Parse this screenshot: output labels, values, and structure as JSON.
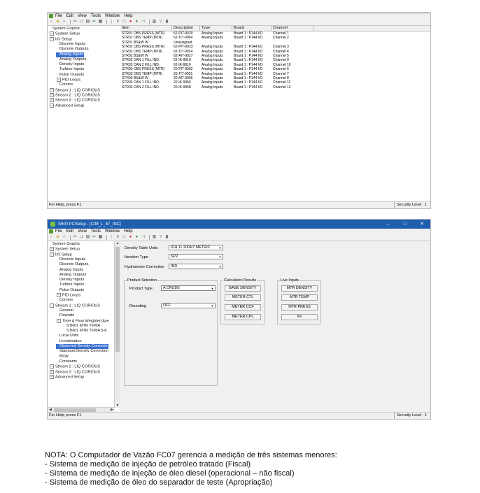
{
  "menu": [
    "File",
    "Edit",
    "View",
    "Tools",
    "Window",
    "Help"
  ],
  "window1": {
    "tree": [
      {
        "label": "System Graphic",
        "type": "leaf"
      },
      {
        "label": "System Setup",
        "type": "exp"
      },
      {
        "label": "I/O Setup",
        "type": "col"
      },
      {
        "label": "Discrete Inputs",
        "type": "leaf"
      },
      {
        "label": "Discrete Outputs",
        "type": "leaf"
      },
      {
        "label": "Analog Inputs",
        "type": "leaf",
        "selected": true
      },
      {
        "label": "Analog Outputs",
        "type": "leaf"
      },
      {
        "label": "Density Inputs",
        "type": "leaf"
      },
      {
        "label": "Turbine Inputs",
        "type": "leaf"
      },
      {
        "label": "Pulse Outputs",
        "type": "leaf"
      },
      {
        "label": "PID Loops",
        "type": "exp"
      },
      {
        "label": "Comms",
        "type": "leaf"
      },
      {
        "label": "Stream 1 : LIQ CORIOUS",
        "type": "exp"
      },
      {
        "label": "Stream 2 : LIQ CORIOUS",
        "type": "exp"
      },
      {
        "label": "Stream 3 : LIQ CORIOUS",
        "type": "exp"
      },
      {
        "label": "Advanced Setup",
        "type": "exp"
      }
    ],
    "columns": [
      "Item",
      "Description",
      "Type",
      "Board",
      "Channel"
    ],
    "rows": [
      [
        "STR01 OBS PRESS (MTR)",
        "62-PIT-9020",
        "Analog Inputs",
        "Board 1 : P144 I/O",
        "Channel 1"
      ],
      [
        "STR01 OBS TEMP (MTR)",
        "62-TIT-9004",
        "Analog Inputs",
        "Board 1 : P144 I/O",
        "Channel 2"
      ],
      [
        "STR01 BS&W W",
        "Unassigned",
        "",
        "",
        ""
      ],
      [
        "STR02 OBS PRESS (MTR)",
        "62-PIT-9023",
        "Analog Inputs",
        "Board 1 : P144 I/O",
        "Channel 3"
      ],
      [
        "STR02 OBS TEMP (MTR)",
        "62-TIT-9024",
        "Analog Inputs",
        "Board 1 : P144 I/O",
        "Channel 4"
      ],
      [
        "STR02 BS&W W",
        "62-AIT-9027",
        "Analog Inputs",
        "Board 1 : P144 I/O",
        "Channel 5"
      ],
      [
        "STR02 CAN 1 FILL IND.",
        "62-IK-9910",
        "Analog Inputs",
        "Board 1 : P144 I/O",
        "Channel 9"
      ],
      [
        "STR02 CAN 2 FILL IND.",
        "62-IK-9910",
        "Analog Inputs",
        "Board 1 : P144 I/O",
        "Channel 10"
      ],
      [
        "STR03 OBS PRESS (MTR)",
        "20-PIT-9002",
        "Analog Inputs",
        "Board 1 : P144 I/O",
        "Channel 6"
      ],
      [
        "STR03 OBS TEMP (MTR)",
        "20-TIT-9001",
        "Analog Inputs",
        "Board 1 : P144 I/O",
        "Channel 7"
      ],
      [
        "STR03 BS&W W",
        "20-AIT-9006",
        "Analog Inputs",
        "Board 1 : P144 I/O",
        "Channel 8"
      ],
      [
        "STR03 CAN 1 FILL IND.",
        "20-IK-9956",
        "Analog Inputs",
        "Board 1 : P144 I/O",
        "Channel 11"
      ],
      [
        "STR03 CAN 2 FILL IND.",
        "20-IK-9958",
        "Analog Inputs",
        "Board 1 : P144 I/O",
        "Channel 12"
      ]
    ],
    "status_left": "For Help, press F1",
    "status_right": "Security Level : 1"
  },
  "window2": {
    "title": "S600 PCSetup - [C/M_L_87_INC]",
    "tree": [
      {
        "label": "System Graphic",
        "type": "leaf"
      },
      {
        "label": "System Setup",
        "type": "exp"
      },
      {
        "label": "I/O Setup",
        "type": "col"
      },
      {
        "label": "Discrete Inputs",
        "type": "leaf"
      },
      {
        "label": "Discrete Outputs",
        "type": "leaf"
      },
      {
        "label": "Analog Inputs",
        "type": "leaf"
      },
      {
        "label": "Analog Outputs",
        "type": "leaf"
      },
      {
        "label": "Density Inputs",
        "type": "leaf"
      },
      {
        "label": "Turbine Inputs",
        "type": "leaf"
      },
      {
        "label": "Pulse Outputs",
        "type": "leaf"
      },
      {
        "label": "PID Loops",
        "type": "exp"
      },
      {
        "label": "Comms",
        "type": "leaf"
      },
      {
        "label": "Stream 1 : LIQ CORIOUS",
        "type": "col"
      },
      {
        "label": "General",
        "type": "leaf"
      },
      {
        "label": "Flowrate",
        "type": "leaf"
      },
      {
        "label": "Time & Flow Weighted Ave",
        "type": "col"
      },
      {
        "label": "STR01 MTR TFWA",
        "type": "leaf"
      },
      {
        "label": "STR01 MTR TFWA 5-8",
        "type": "leaf"
      },
      {
        "label": "Local Units",
        "type": "leaf"
      },
      {
        "label": "Linearisation",
        "type": "leaf"
      },
      {
        "label": "Observed Density Correctio",
        "type": "leaf",
        "selected": true
      },
      {
        "label": "Standard Density Correction",
        "type": "leaf"
      },
      {
        "label": "BSW",
        "type": "leaf"
      },
      {
        "label": "Constants",
        "type": "leaf"
      },
      {
        "label": "Stream 2 : LIQ CORIOUS",
        "type": "exp"
      },
      {
        "label": "Stream 3 : LIQ CORIOUS",
        "type": "exp"
      },
      {
        "label": "Advanced Setup",
        "type": "exp"
      }
    ],
    "form": {
      "density_table_units_label": "Density Table Units",
      "density_table_units_value": "ICH 11 2004/7 METRIC",
      "iteration_type_label": "Iteration Type",
      "iteration_type_value": "SP2",
      "hydrometer_label": "Hydrometer Correction",
      "hydrometer_value": "IND",
      "product_selection_title": "Product Selection",
      "product_type_label": "Product Type",
      "product_type_value": "A CRUDE",
      "rounding_label": "Rounding",
      "rounding_value": "OFF",
      "calc_results_title": "Calculation Results",
      "calc_buttons": [
        "BASE DENSITY",
        "METER CTL",
        "METER CCF",
        "METER CPL"
      ],
      "live_inputs_title": "Live Inputs",
      "live_buttons": [
        "MTR DENSITY",
        "MTR TEMP",
        "MTR PRESS",
        "Pe"
      ]
    },
    "status_left": "For Help, press F1",
    "status_right": "Security Level : 1"
  },
  "note": {
    "lines": [
      "NOTA: O Computador de Vazão FC07 gerencia a medição de três sistemas menores:",
      "- Sistema de medição de injeção de petróleo tratado (Fiscal)",
      "- Sistema de medição de injeção de óleo diesel (operacional – não fiscal)",
      "- Sistema de medição de óleo do separador de teste (Apropriação)"
    ]
  }
}
